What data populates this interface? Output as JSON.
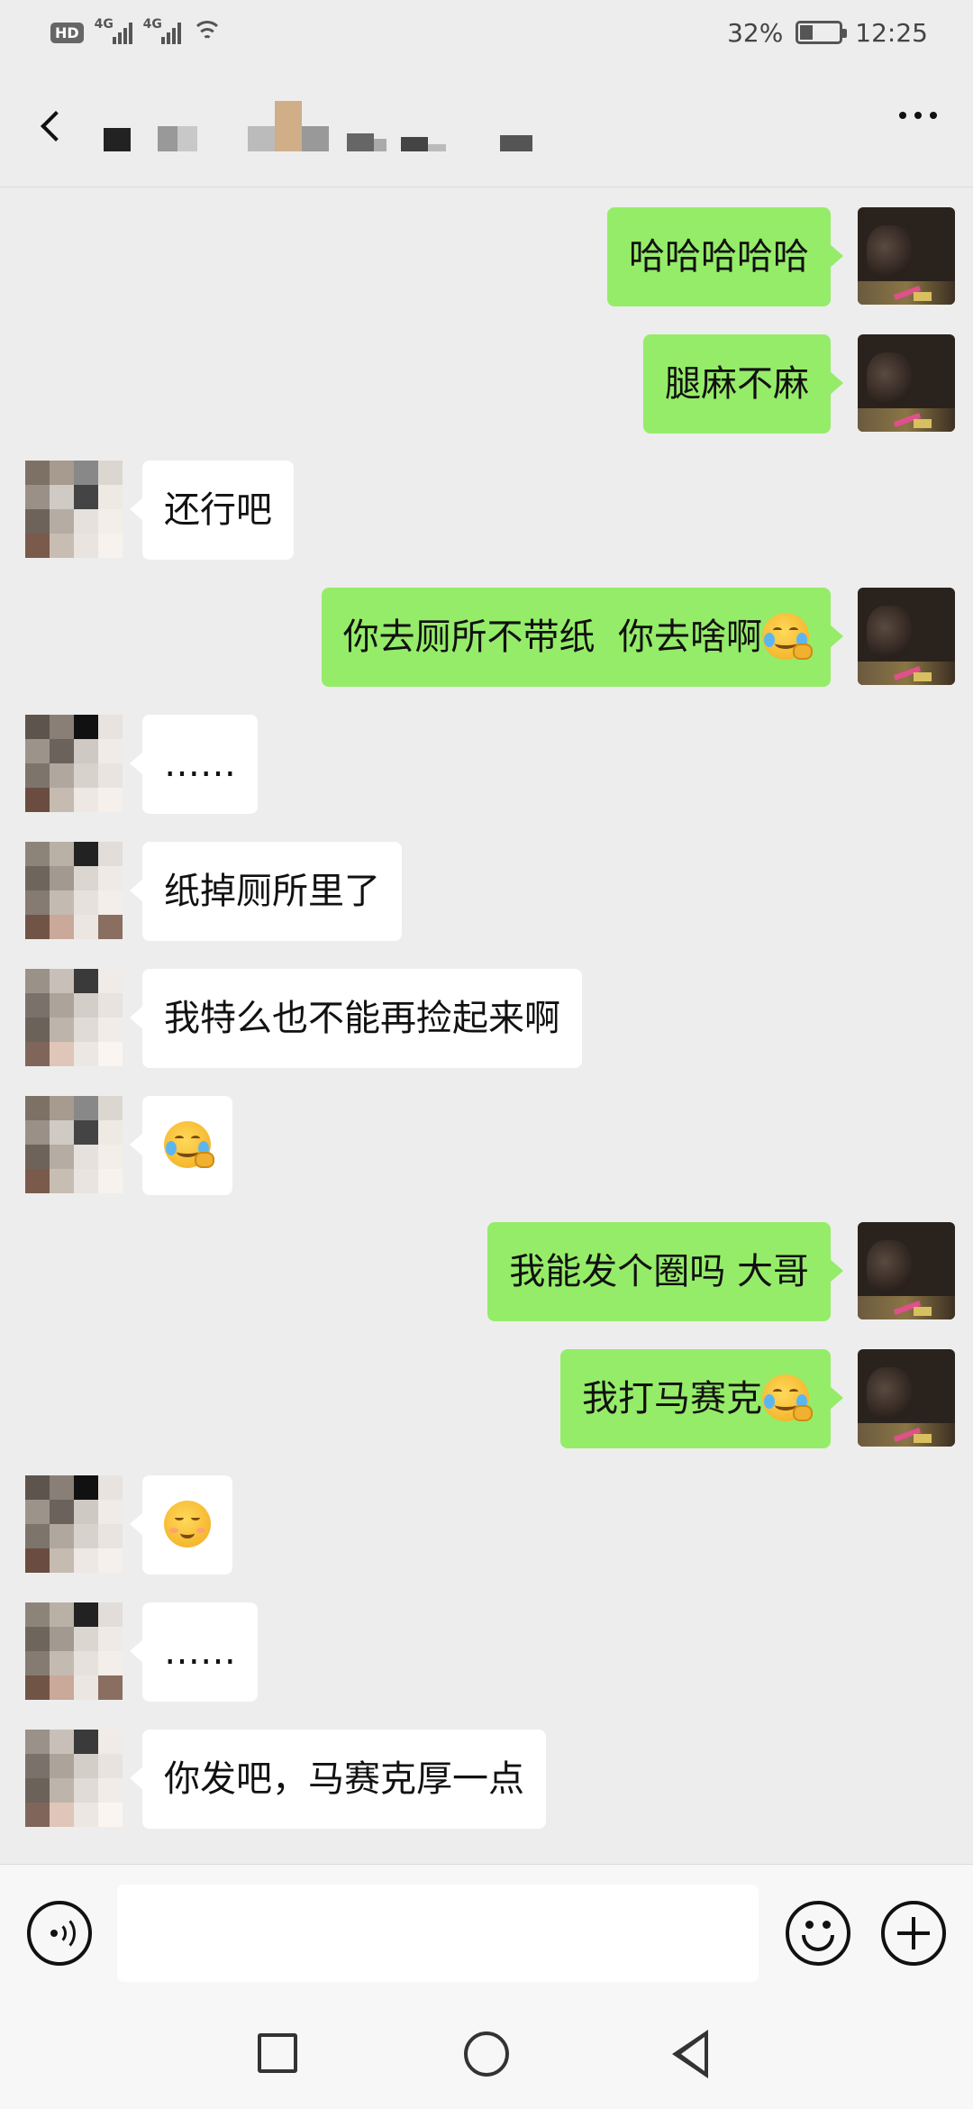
{
  "status_bar": {
    "badge": "HD",
    "network_1": "4G",
    "network_2": "4G",
    "battery_percent": "32%",
    "battery_level": 0.32,
    "time": "12:25"
  },
  "header": {
    "back_icon": "chevron-left-icon",
    "more_icon": "more-dots-icon"
  },
  "messages": [
    {
      "from": "me",
      "text": "哈哈哈哈哈"
    },
    {
      "from": "me",
      "text": "腿麻不麻"
    },
    {
      "from": "other",
      "text": "还行吧"
    },
    {
      "from": "me",
      "text": "你去厕所不带纸  你去啥啊",
      "emoji": "facepalm-emoji"
    },
    {
      "from": "other",
      "text": "……"
    },
    {
      "from": "other",
      "text": "纸掉厕所里了"
    },
    {
      "from": "other",
      "text": "我特么也不能再捡起来啊"
    },
    {
      "from": "other",
      "text": "",
      "emoji": "facepalm-emoji"
    },
    {
      "from": "me",
      "text": "我能发个圈吗 大哥"
    },
    {
      "from": "me",
      "text": "我打马赛克",
      "emoji": "facepalm-emoji"
    },
    {
      "from": "other",
      "text": "",
      "emoji": "blush-smile-emoji"
    },
    {
      "from": "other",
      "text": "……"
    },
    {
      "from": "other",
      "text": "你发吧，马赛克厚一点"
    }
  ],
  "input_bar": {
    "voice_icon": "voice-icon",
    "input_value": "",
    "emoji_icon": "emoji-icon",
    "plus_icon": "plus-icon"
  },
  "nav_bar": {
    "recents_icon": "square-icon",
    "home_icon": "circle-icon",
    "back_icon": "triangle-back-icon"
  },
  "colors": {
    "background": "#ededed",
    "my_bubble": "#95ec69",
    "other_bubble": "#ffffff"
  }
}
